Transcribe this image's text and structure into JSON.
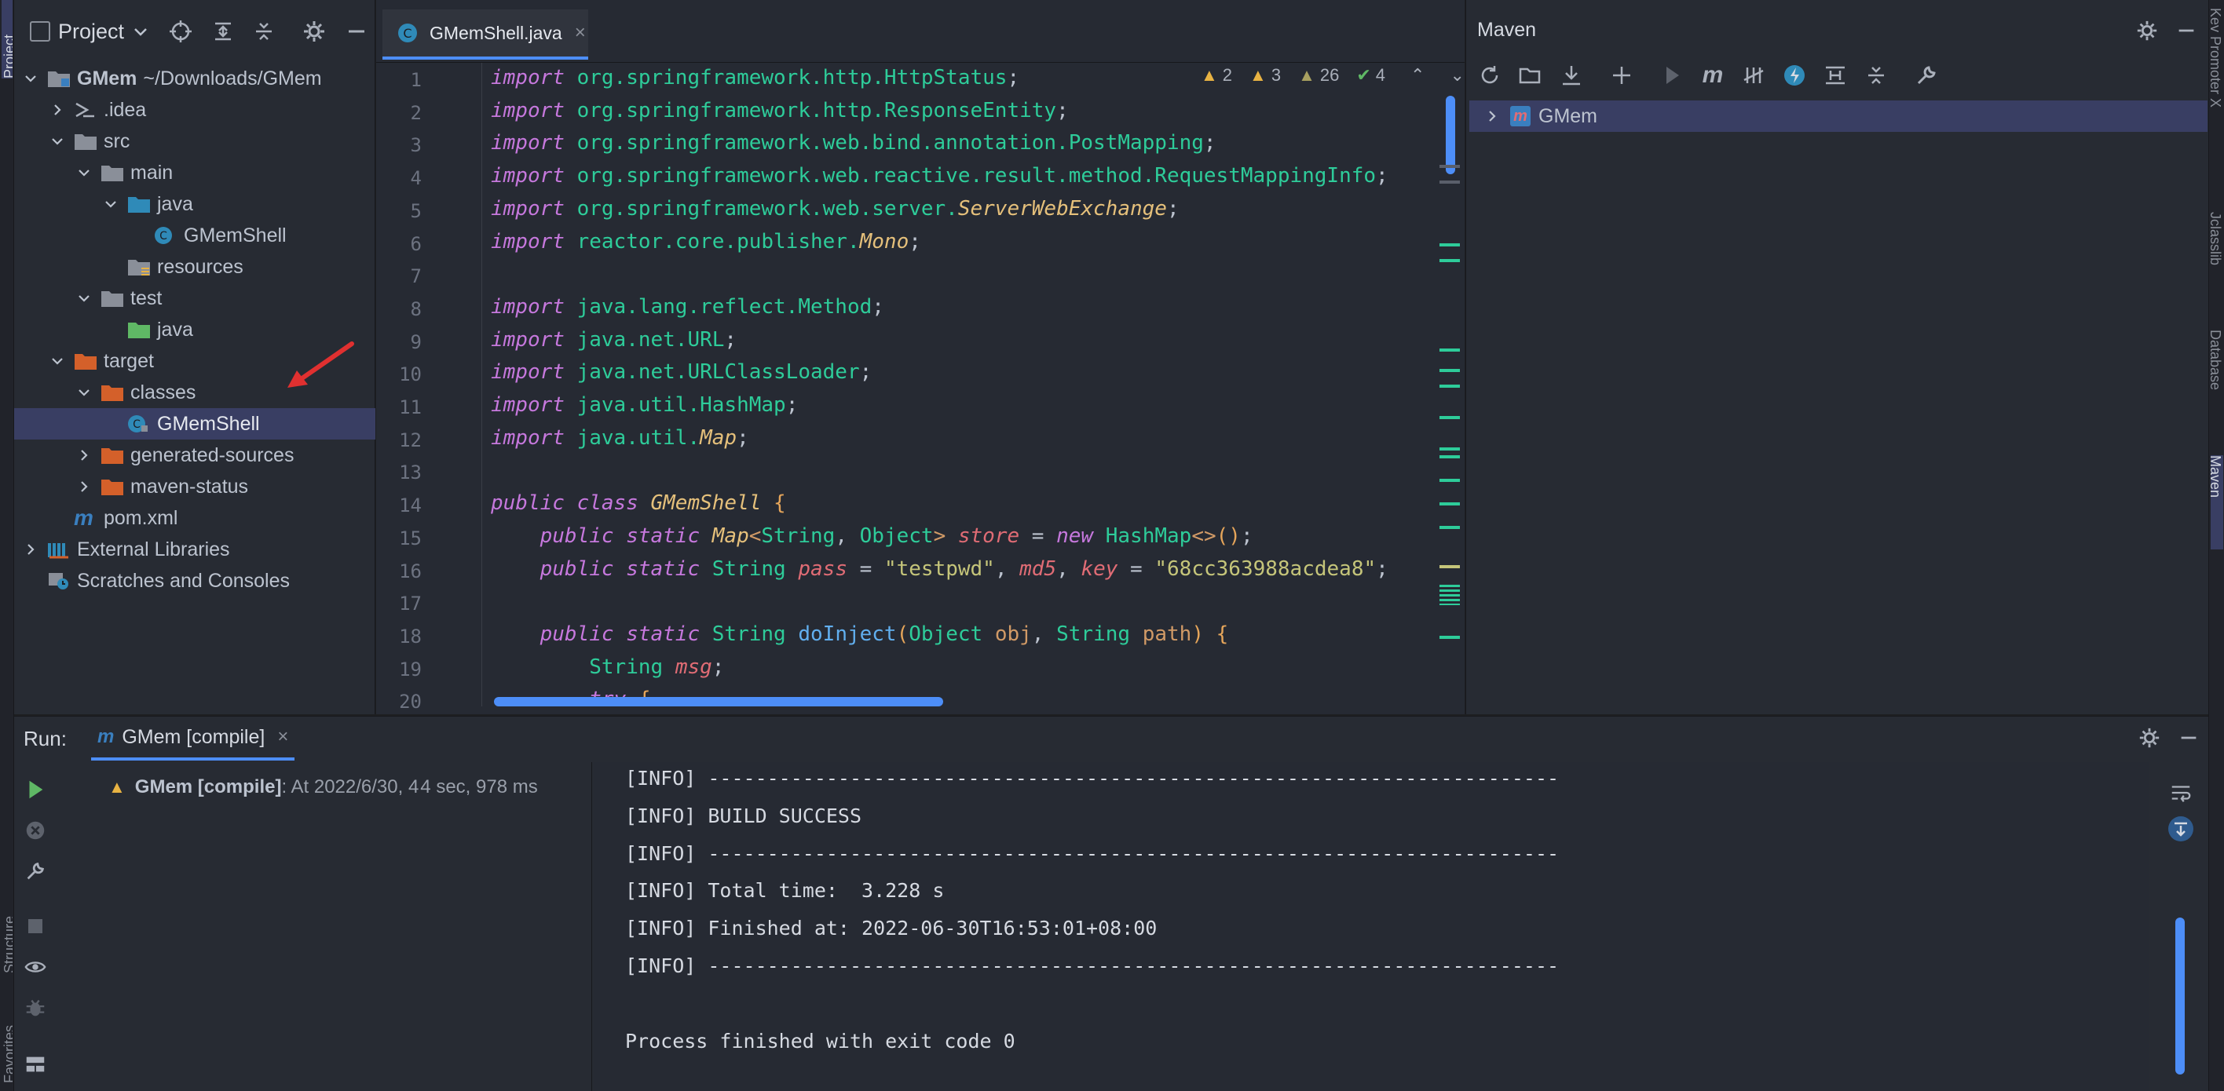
{
  "project": {
    "title": "Project",
    "tree": [
      {
        "label": "GMem",
        "suffix": "~/Downloads/GMem",
        "level": 0,
        "expanded": true,
        "icon": "module-folder-icon",
        "bold": true
      },
      {
        "label": ".idea",
        "level": 1,
        "expanded": false,
        "icon": "idea-folder-icon"
      },
      {
        "label": "src",
        "level": 1,
        "expanded": true,
        "icon": "folder-icon"
      },
      {
        "label": "main",
        "level": 2,
        "expanded": true,
        "icon": "folder-icon"
      },
      {
        "label": "java",
        "level": 3,
        "expanded": true,
        "icon": "source-folder-icon"
      },
      {
        "label": "GMemShell",
        "level": 4,
        "icon": "java-class-icon"
      },
      {
        "label": "resources",
        "level": 3,
        "icon": "resources-folder-icon"
      },
      {
        "label": "test",
        "level": 2,
        "expanded": true,
        "icon": "folder-icon"
      },
      {
        "label": "java",
        "level": 3,
        "icon": "test-source-folder-icon"
      },
      {
        "label": "target",
        "level": 1,
        "expanded": true,
        "icon": "excluded-folder-icon"
      },
      {
        "label": "classes",
        "level": 2,
        "expanded": true,
        "icon": "excluded-folder-icon"
      },
      {
        "label": "GMemShell",
        "level": 3,
        "icon": "class-file-icon",
        "selected": true
      },
      {
        "label": "generated-sources",
        "level": 2,
        "expanded": false,
        "icon": "excluded-folder-icon"
      },
      {
        "label": "maven-status",
        "level": 2,
        "expanded": false,
        "icon": "excluded-folder-icon"
      },
      {
        "label": "pom.xml",
        "level": 1,
        "icon": "maven-icon"
      },
      {
        "label": "External Libraries",
        "level": 0,
        "expanded": false,
        "icon": "libraries-icon"
      },
      {
        "label": "Scratches and Consoles",
        "level": 0,
        "icon": "scratches-icon"
      }
    ]
  },
  "editor": {
    "tab_label": "GMemShell.java",
    "inspections": {
      "warn_a": "2",
      "warn_b": "3",
      "warn_c": "26",
      "ok": "4"
    },
    "line_numbers": [
      "1",
      "2",
      "3",
      "4",
      "5",
      "6",
      "7",
      "8",
      "9",
      "10",
      "11",
      "12",
      "13",
      "14",
      "15",
      "16",
      "17",
      "18",
      "19",
      "20"
    ],
    "lines": [
      [
        [
          "kw",
          "import"
        ],
        [
          "t",
          " "
        ],
        [
          "pk",
          "org.springframework.http.HttpStatus"
        ],
        [
          "t",
          ";"
        ]
      ],
      [
        [
          "kw",
          "import"
        ],
        [
          "t",
          " "
        ],
        [
          "pk",
          "org.springframework.http.ResponseEntity"
        ],
        [
          "t",
          ";"
        ]
      ],
      [
        [
          "kw",
          "import"
        ],
        [
          "t",
          " "
        ],
        [
          "pk",
          "org.springframework.web.bind.annotation.PostMapping"
        ],
        [
          "t",
          ";"
        ]
      ],
      [
        [
          "kw",
          "import"
        ],
        [
          "t",
          " "
        ],
        [
          "pk",
          "org.springframework.web.reactive.result.method.RequestMappingInfo"
        ],
        [
          "t",
          ";"
        ]
      ],
      [
        [
          "kw",
          "import"
        ],
        [
          "t",
          " "
        ],
        [
          "pk",
          "org.springframework.web.server."
        ],
        [
          "ty",
          "ServerWebExchange"
        ],
        [
          "t",
          ";"
        ]
      ],
      [
        [
          "kw",
          "import"
        ],
        [
          "t",
          " "
        ],
        [
          "pk",
          "reactor.core.publisher."
        ],
        [
          "ty",
          "Mono"
        ],
        [
          "t",
          ";"
        ]
      ],
      [],
      [
        [
          "kw",
          "import"
        ],
        [
          "t",
          " "
        ],
        [
          "pk",
          "java.lang.reflect.Method"
        ],
        [
          "t",
          ";"
        ]
      ],
      [
        [
          "kw",
          "import"
        ],
        [
          "t",
          " "
        ],
        [
          "pk",
          "java.net.URL"
        ],
        [
          "t",
          ";"
        ]
      ],
      [
        [
          "kw",
          "import"
        ],
        [
          "t",
          " "
        ],
        [
          "pk",
          "java.net.URLClassLoader"
        ],
        [
          "t",
          ";"
        ]
      ],
      [
        [
          "kw",
          "import"
        ],
        [
          "t",
          " "
        ],
        [
          "pk",
          "java.util.HashMap"
        ],
        [
          "t",
          ";"
        ]
      ],
      [
        [
          "kw",
          "import"
        ],
        [
          "t",
          " "
        ],
        [
          "pk",
          "java.util."
        ],
        [
          "ty",
          "Map"
        ],
        [
          "t",
          ";"
        ]
      ],
      [],
      [
        [
          "kw",
          "public class"
        ],
        [
          "t",
          " "
        ],
        [
          "ty",
          "GMemShell"
        ],
        [
          "t",
          " "
        ],
        [
          "par",
          "{"
        ]
      ],
      [
        [
          "t",
          "    "
        ],
        [
          "kw",
          "public static"
        ],
        [
          "t",
          " "
        ],
        [
          "ty",
          "Map"
        ],
        [
          "op",
          "<"
        ],
        [
          "pk",
          "String"
        ],
        [
          "t",
          ", "
        ],
        [
          "pk",
          "Object"
        ],
        [
          "op",
          ">"
        ],
        [
          "t",
          " "
        ],
        [
          "var",
          "store"
        ],
        [
          "t",
          " = "
        ],
        [
          "kw",
          "new"
        ],
        [
          "t",
          " "
        ],
        [
          "pk",
          "HashMap"
        ],
        [
          "op",
          "<>"
        ],
        [
          "par",
          "()"
        ],
        [
          "t",
          ";"
        ]
      ],
      [
        [
          "t",
          "    "
        ],
        [
          "kw",
          "public static"
        ],
        [
          "t",
          " "
        ],
        [
          "pk",
          "String"
        ],
        [
          "t",
          " "
        ],
        [
          "var",
          "pass"
        ],
        [
          "t",
          " = "
        ],
        [
          "str",
          "\"testpwd\""
        ],
        [
          "t",
          ", "
        ],
        [
          "var",
          "md5"
        ],
        [
          "t",
          ", "
        ],
        [
          "var",
          "key"
        ],
        [
          "t",
          " = "
        ],
        [
          "str",
          "\"68cc363988acdea8\""
        ],
        [
          "t",
          ";"
        ]
      ],
      [],
      [
        [
          "t",
          "    "
        ],
        [
          "kw",
          "public static"
        ],
        [
          "t",
          " "
        ],
        [
          "pk",
          "String"
        ],
        [
          "t",
          " "
        ],
        [
          "fn",
          "doInject"
        ],
        [
          "par",
          "("
        ],
        [
          "pk",
          "Object"
        ],
        [
          "t",
          " "
        ],
        [
          "op",
          "obj"
        ],
        [
          "t",
          ", "
        ],
        [
          "pk",
          "String"
        ],
        [
          "t",
          " "
        ],
        [
          "op",
          "path"
        ],
        [
          "par",
          ")"
        ],
        [
          "t",
          " "
        ],
        [
          "par",
          "{"
        ]
      ],
      [
        [
          "t",
          "        "
        ],
        [
          "pk",
          "String"
        ],
        [
          "t",
          " "
        ],
        [
          "var",
          "msg"
        ],
        [
          "t",
          ";"
        ]
      ],
      [
        [
          "t",
          "        "
        ],
        [
          "kw",
          "try"
        ],
        [
          "t",
          " "
        ],
        [
          "par",
          "{"
        ]
      ]
    ]
  },
  "maven": {
    "title": "Maven",
    "root": "GMem"
  },
  "run": {
    "label": "Run:",
    "tab": "GMem [compile]",
    "tree_name": "GMem [compile]",
    "tree_detail": ": At 2022/6/30, 4",
    "tree_time": "4 sec, 978 ms",
    "console": [
      "[INFO] ------------------------------------------------------------------------",
      "[INFO] BUILD SUCCESS",
      "[INFO] ------------------------------------------------------------------------",
      "[INFO] Total time:  3.228 s",
      "[INFO] Finished at: 2022-06-30T16:53:01+08:00",
      "[INFO] ------------------------------------------------------------------------",
      "",
      "Process finished with exit code 0"
    ]
  },
  "side": {
    "left_top": "Project",
    "left_structure": "Structure",
    "left_favorites": "Favorites",
    "right_key": "Key Promoter X",
    "right_jsclasses": "Jclasslib",
    "right_database": "Database",
    "right_maven": "Maven"
  },
  "colors": {
    "accent": "#4d8ef8",
    "selection": "#393e63",
    "keyword": "#c678dd",
    "package": "#2ecc9a",
    "string": "#c5c57a"
  }
}
